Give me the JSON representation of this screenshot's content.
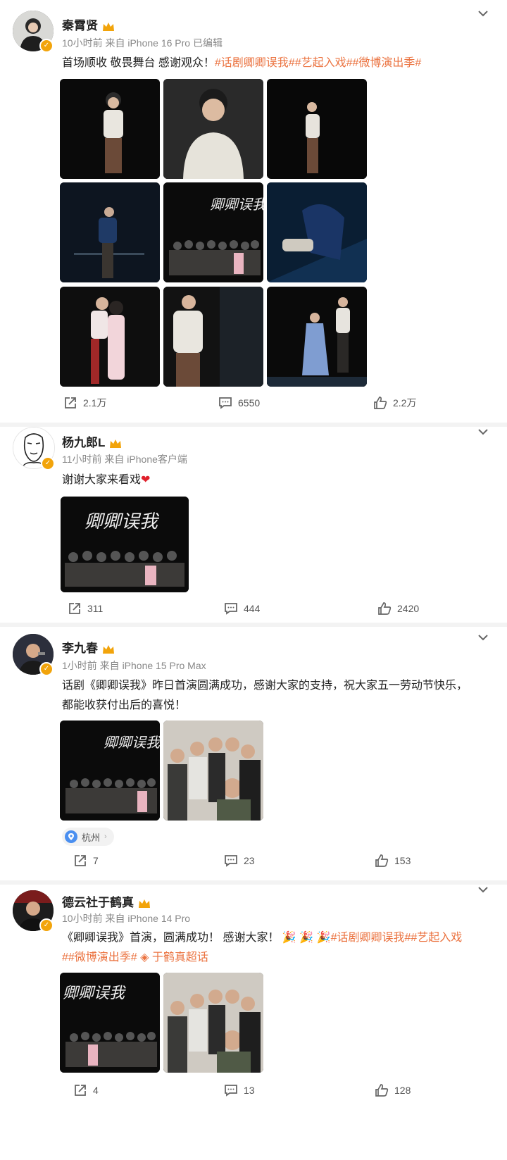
{
  "posts": [
    {
      "username": "秦霄贤",
      "meta": "10小时前 来自 iPhone 16 Pro 已编辑",
      "text_plain": "首场顺收  敬畏舞台  感谢观众！",
      "text_tags": "#话剧卿卿误我##艺起入戏##微博演出季#",
      "reposts": "2.1万",
      "comments": "6550",
      "likes": "2.2万"
    },
    {
      "username": "杨九郎L",
      "meta": "11小时前 来自 iPhone客户端",
      "text_plain": "谢谢大家来看戏",
      "reposts": "311",
      "comments": "444",
      "likes": "2420"
    },
    {
      "username": "李九春",
      "meta": "1小时前 来自 iPhone 15 Pro Max",
      "text_line1": "话剧《卿卿误我》昨日首演圆满成功，感谢大家的支持，祝大家五一劳动节快乐，",
      "text_line2": "都能收获付出后的喜悦！",
      "location": "杭州",
      "reposts": "7",
      "comments": "23",
      "likes": "153"
    },
    {
      "username": "德云社于鹤真",
      "meta": "10小时前 来自 iPhone 14 Pro",
      "text_line1_plain": "《卿卿误我》首演，圆满成功！ 感谢大家！ ",
      "text_line1_tags": "#话剧卿卿误我##艺起入戏",
      "text_line2_tags": "##微博演出季# ",
      "supertopic": "于鹤真超话",
      "reposts": "4",
      "comments": "13",
      "likes": "128"
    }
  ],
  "image_caption": "卿卿误我",
  "colors": {
    "accent": "#eb7340",
    "badge": "#f2a40b",
    "text": "#222222",
    "meta": "#888888"
  }
}
